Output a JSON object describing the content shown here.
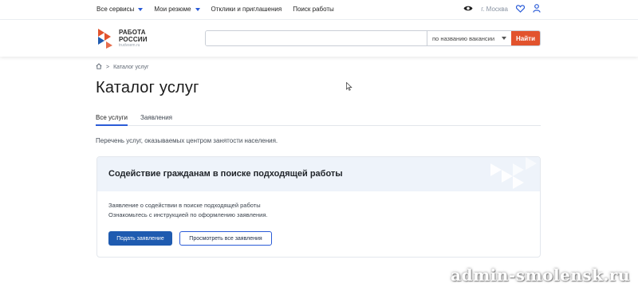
{
  "topnav": {
    "items": [
      {
        "label": "Все сервисы",
        "has_caret": true
      },
      {
        "label": "Мои резюме",
        "has_caret": true
      },
      {
        "label": "Отклики и приглашения",
        "has_caret": false
      },
      {
        "label": "Поиск работы",
        "has_caret": false
      }
    ],
    "city": "г. Москва",
    "icons": [
      "eye-icon",
      "heart-icon",
      "user-icon"
    ]
  },
  "header": {
    "logo_line1": "РАБОТА",
    "logo_line2": "РОССИИ",
    "logo_sub": "trudvsem.ru",
    "search_value": "",
    "search_mode": "по названию вакансии",
    "search_button": "Найти"
  },
  "breadcrumb": {
    "current": "Каталог услуг"
  },
  "page": {
    "title": "Каталог услуг",
    "tabs": [
      {
        "label": "Все услуги",
        "active": true
      },
      {
        "label": "Заявления",
        "active": false
      }
    ],
    "description": "Перечень услуг, оказываемых центром занятости населения."
  },
  "card": {
    "title": "Содействие гражданам в поиске подходящей работы",
    "line1": "Заявление о содействии в поиске подходящей работы",
    "line2": "Ознакомьтесь с инструкцией по оформлению заявления.",
    "primary_button": "Подать заявление",
    "secondary_button": "Просмотреть все заявления"
  },
  "watermark": "admin-smolensk.ru",
  "colors": {
    "accent_blue": "#1f5bb0",
    "brand_orange": "#e2532d",
    "card_header_bg": "#eef3fa"
  }
}
